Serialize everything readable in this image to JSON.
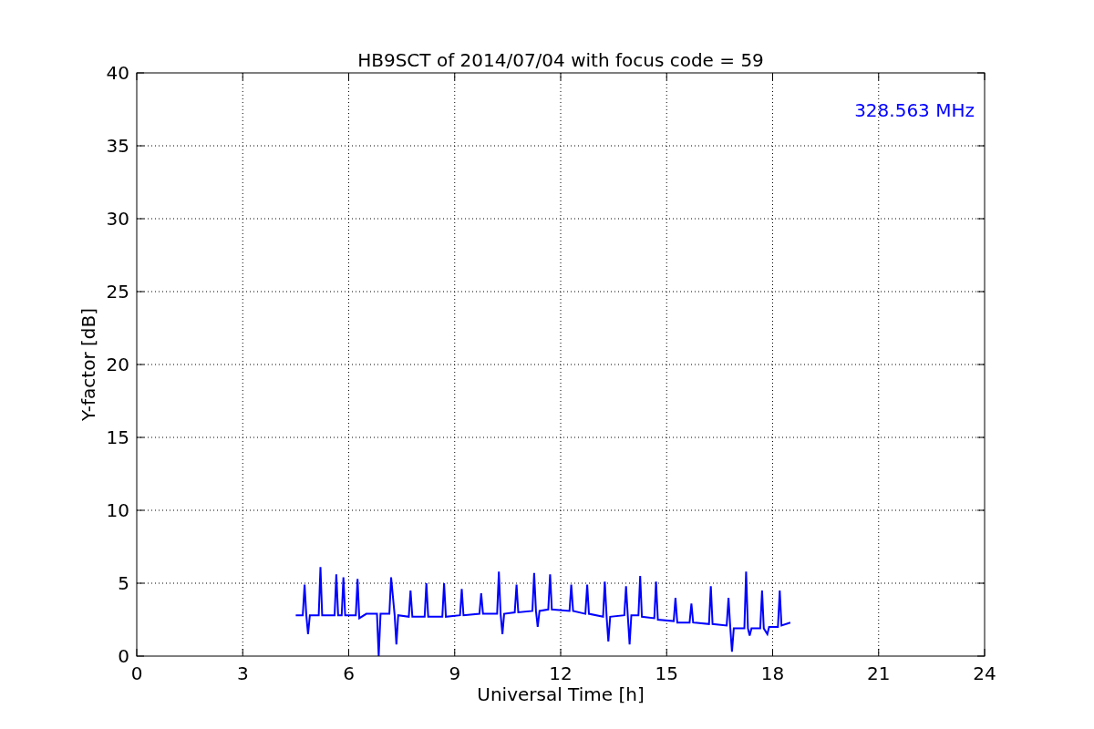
{
  "chart_data": {
    "type": "line",
    "title": "HB9SCT of 2014/07/04 with focus code = 59",
    "xlabel": "Universal Time [h]",
    "ylabel": "Y-factor [dB]",
    "xlim": [
      0,
      24
    ],
    "ylim": [
      0,
      40
    ],
    "xticks": [
      0,
      3,
      6,
      9,
      12,
      15,
      18,
      21,
      24
    ],
    "yticks": [
      0,
      5,
      10,
      15,
      20,
      25,
      30,
      35,
      40
    ],
    "x": [
      4.5,
      4.7,
      4.75,
      4.8,
      4.85,
      4.9,
      5.15,
      5.2,
      5.25,
      5.6,
      5.65,
      5.7,
      5.8,
      5.85,
      5.9,
      6.2,
      6.25,
      6.3,
      6.5,
      6.8,
      6.85,
      6.9,
      7.15,
      7.2,
      7.3,
      7.35,
      7.4,
      7.7,
      7.75,
      7.8,
      8.15,
      8.2,
      8.25,
      8.65,
      8.7,
      8.75,
      9.15,
      9.2,
      9.25,
      9.7,
      9.75,
      9.8,
      10.2,
      10.25,
      10.3,
      10.35,
      10.4,
      10.7,
      10.75,
      10.8,
      11.2,
      11.25,
      11.3,
      11.35,
      11.4,
      11.65,
      11.7,
      11.75,
      12.25,
      12.3,
      12.35,
      12.7,
      12.75,
      12.8,
      13.2,
      13.25,
      13.3,
      13.35,
      13.4,
      13.8,
      13.85,
      13.9,
      13.95,
      14.0,
      14.2,
      14.25,
      14.3,
      14.65,
      14.7,
      14.75,
      15.2,
      15.25,
      15.3,
      15.65,
      15.7,
      15.75,
      16.2,
      16.25,
      16.3,
      16.7,
      16.75,
      16.8,
      16.85,
      16.9,
      17.2,
      17.25,
      17.3,
      17.35,
      17.4,
      17.65,
      17.7,
      17.75,
      17.85,
      17.9,
      18.15,
      18.2,
      18.25,
      18.5
    ],
    "series": [
      {
        "name": "328.563 MHz",
        "color": "#0000ff",
        "values": [
          2.8,
          2.8,
          4.9,
          2.8,
          1.5,
          2.8,
          2.8,
          6.1,
          2.8,
          2.8,
          5.6,
          2.8,
          2.8,
          5.4,
          2.8,
          2.8,
          5.3,
          2.6,
          2.9,
          2.9,
          0,
          2.9,
          2.9,
          5.4,
          2.8,
          0.8,
          2.8,
          2.7,
          4.5,
          2.7,
          2.7,
          5.0,
          2.7,
          2.7,
          5.0,
          2.7,
          2.8,
          4.6,
          2.8,
          2.9,
          4.3,
          2.9,
          2.9,
          5.8,
          2.9,
          1.5,
          2.9,
          3.0,
          4.9,
          3.0,
          3.1,
          5.7,
          3.1,
          2.0,
          3.1,
          3.2,
          5.6,
          3.2,
          3.1,
          4.9,
          3.1,
          2.9,
          4.9,
          2.9,
          2.7,
          5.1,
          2.7,
          1.0,
          2.7,
          2.8,
          4.8,
          2.8,
          0.8,
          2.8,
          2.8,
          5.5,
          2.7,
          2.6,
          5.1,
          2.5,
          2.4,
          4.0,
          2.3,
          2.3,
          3.6,
          2.3,
          2.2,
          4.8,
          2.2,
          2.1,
          4.0,
          2.0,
          0.3,
          1.9,
          1.9,
          5.8,
          1.9,
          1.4,
          1.9,
          1.9,
          4.5,
          1.9,
          1.5,
          2.0,
          2.0,
          4.5,
          2.1,
          2.3
        ]
      }
    ],
    "grid": true
  }
}
